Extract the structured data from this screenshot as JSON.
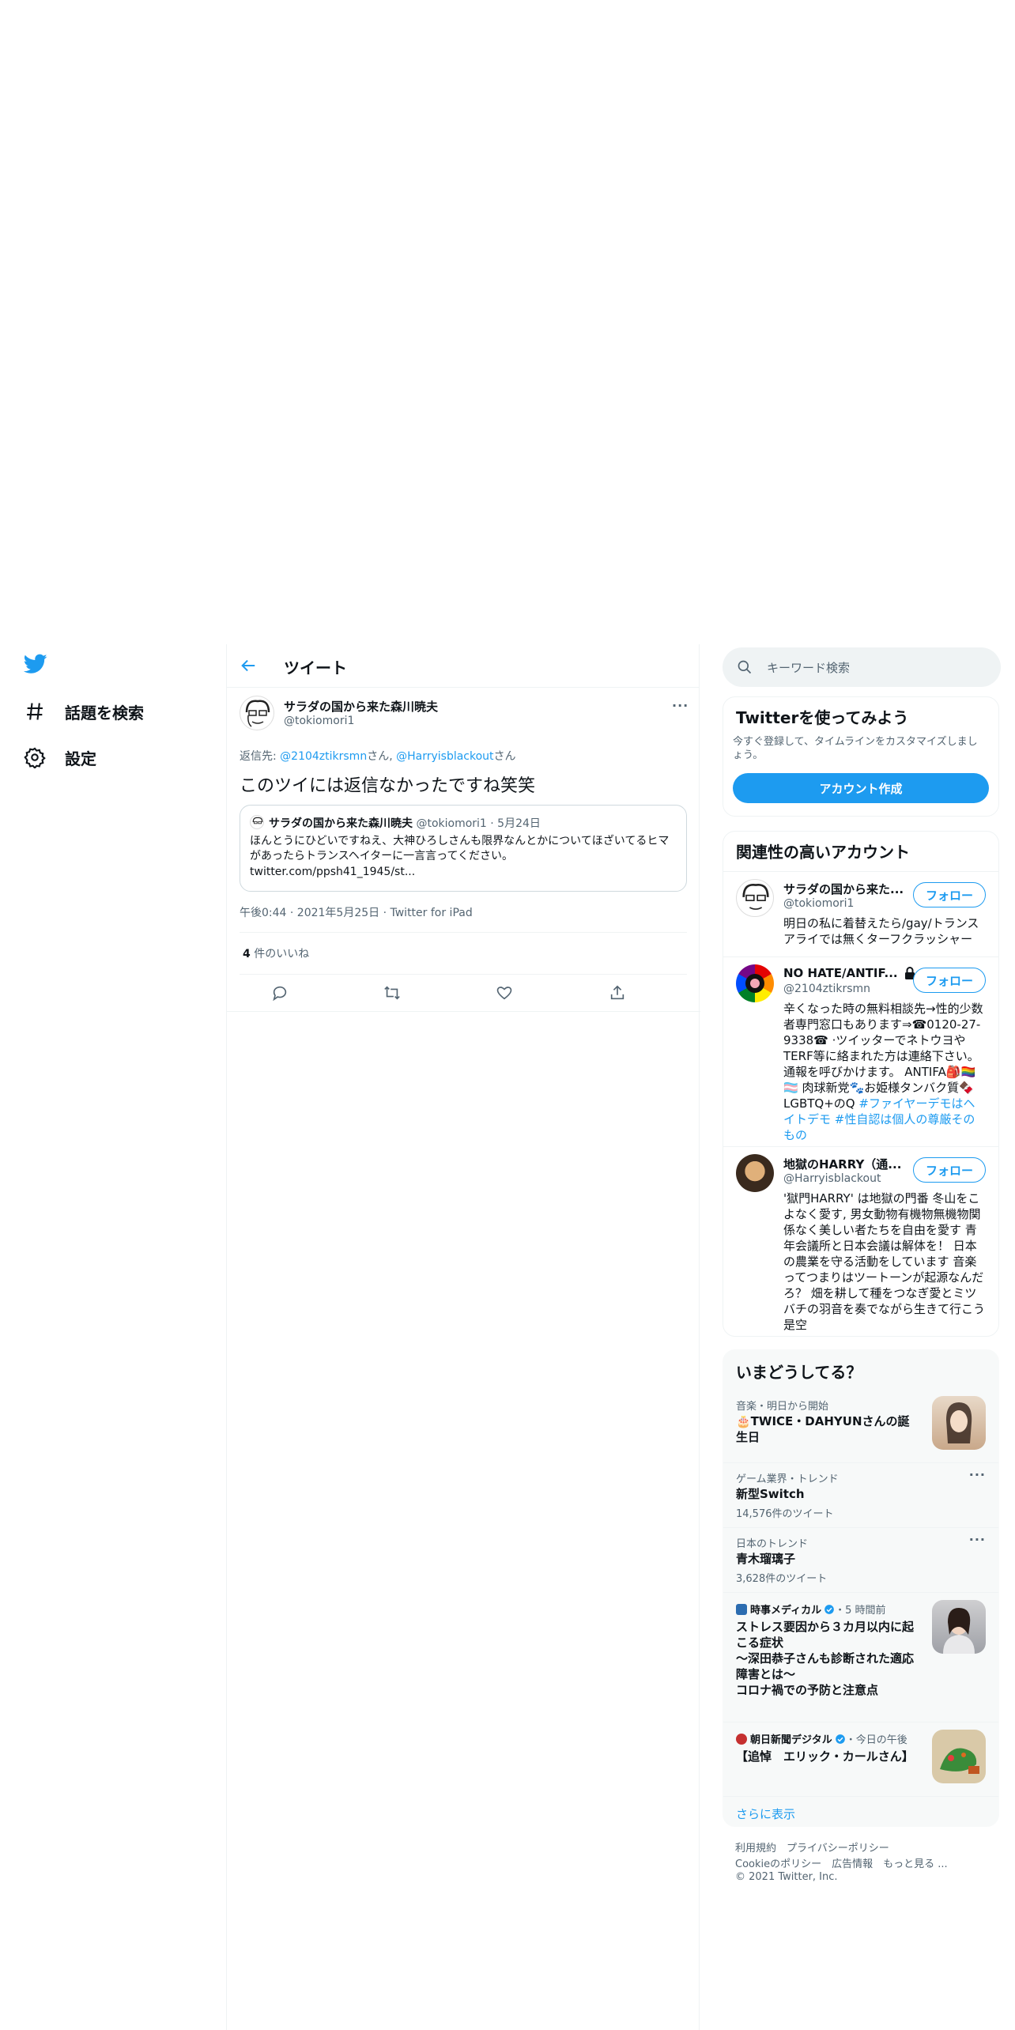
{
  "nav": {
    "items": [
      {
        "label": "話題を検索",
        "icon": "hashtag-icon"
      },
      {
        "label": "設定",
        "icon": "gear-icon"
      }
    ]
  },
  "header": {
    "title": "ツイート"
  },
  "tweet": {
    "author_name": "サラダの国から来た森川暁夫",
    "author_handle": "@tokiomori1",
    "reply_prefix": "返信先: ",
    "reply_user1": "@2104ztikrsmn",
    "reply_san1": "さん, ",
    "reply_user2": "@Harryisblackout",
    "reply_san2": "さん",
    "text": "このツイには返信なかったですね笑笑",
    "quote": {
      "author_name": "サラダの国から来た森川暁夫",
      "meta": "@tokiomori1 · 5月24日",
      "text": "ほんとうにひどいですねえ、大神ひろしさんも限界なんとかについてほざいてるヒマがあったらトランスヘイターに一言言ってください。",
      "link": "twitter.com/ppsh41_1945/st..."
    },
    "timestamp": "午後0:44 · 2021年5月25日 · Twitter for iPad",
    "likes_count": "4",
    "likes_label": " 件のいいね"
  },
  "search": {
    "placeholder": "キーワード検索"
  },
  "signup": {
    "title": "Twitterを使ってみよう",
    "subtitle_l1": "今すぐ登録して、タイムラインをカスタマイズしまし",
    "subtitle_l2": "ょう。",
    "button": "アカウント作成"
  },
  "relevant": {
    "title": "関連性の高いアカウント",
    "follow_label": "フォロー",
    "accounts": [
      {
        "name": "サラダの国から来た...",
        "handle": "@tokiomori1",
        "bio": "明日の私に着替えたら/gay/トランスアライでは無くターフクラッシャー"
      },
      {
        "name": "NO HATE/ANTIF...",
        "handle": "@2104ztikrsmn",
        "bio": "辛くなった時の無料相談先→性的少数者専門窓口もあります⇒☎0120-27-9338☎ ·ツイッターでネトウヨやTERF等に絡まれた方は連絡下さい。通報を呼びかけます。 ANTIFA🎒🏳️‍🌈🏳️‍⚧️ 肉球新党🐾お姫様タンバク質🍫 LGBTQ+のQ ",
        "bio_tags": "#ファイヤーデモはヘイトデモ #性自認は個人の尊厳そのもの"
      },
      {
        "name": "地獄のHARRY（通...",
        "handle": "@Harryisblackout",
        "bio": "'獄門HARRY' は地獄の門番 冬山をこよなく愛す, 男女動物有機物無機物関係なく美しい者たちを自由を愛す 青年会議所と日本会議は解体を！ 日本の農業を守る活動をしています 音楽ってつまりはツートーンが起源なんだろ？ 畑を耕して種をつなぎ愛とミツバチの羽音を奏でながら生きて行こう是空"
      }
    ]
  },
  "trends": {
    "title": "いまどうしてる？",
    "items": [
      {
        "meta": "音楽・明日から開始",
        "title": "🎂TWICE・DAHYUNさんの誕生日"
      },
      {
        "meta": "ゲーム業界・トレンド",
        "title": "新型Switch",
        "count": "14,576件のツイート"
      },
      {
        "meta": "日本のトレンド",
        "title": "青木瑠璃子",
        "count": "3,628件のツイート"
      },
      {
        "meta_source": "時事メディカル",
        "meta_time": "・5 時間前",
        "title": "ストレス要因から３カ月以内に起こる症状\n～深田恭子さんも診断された適応障害とは～\nコロナ禍での予防と注意点"
      },
      {
        "meta_source": "朝日新聞デジタル",
        "meta_time": "・今日の午後",
        "title": "【追悼　エリック・カールさん】"
      }
    ],
    "show_more": "さらに表示"
  },
  "footer": {
    "line1": "利用規約　プライバシーポリシー",
    "line2": "Cookieのポリシー　広告情報　もっと見る ...",
    "line3": "© 2021 Twitter, Inc."
  },
  "colors": {
    "accent": "#1d9bf0",
    "text": "#0f1419",
    "muted": "#536471"
  }
}
